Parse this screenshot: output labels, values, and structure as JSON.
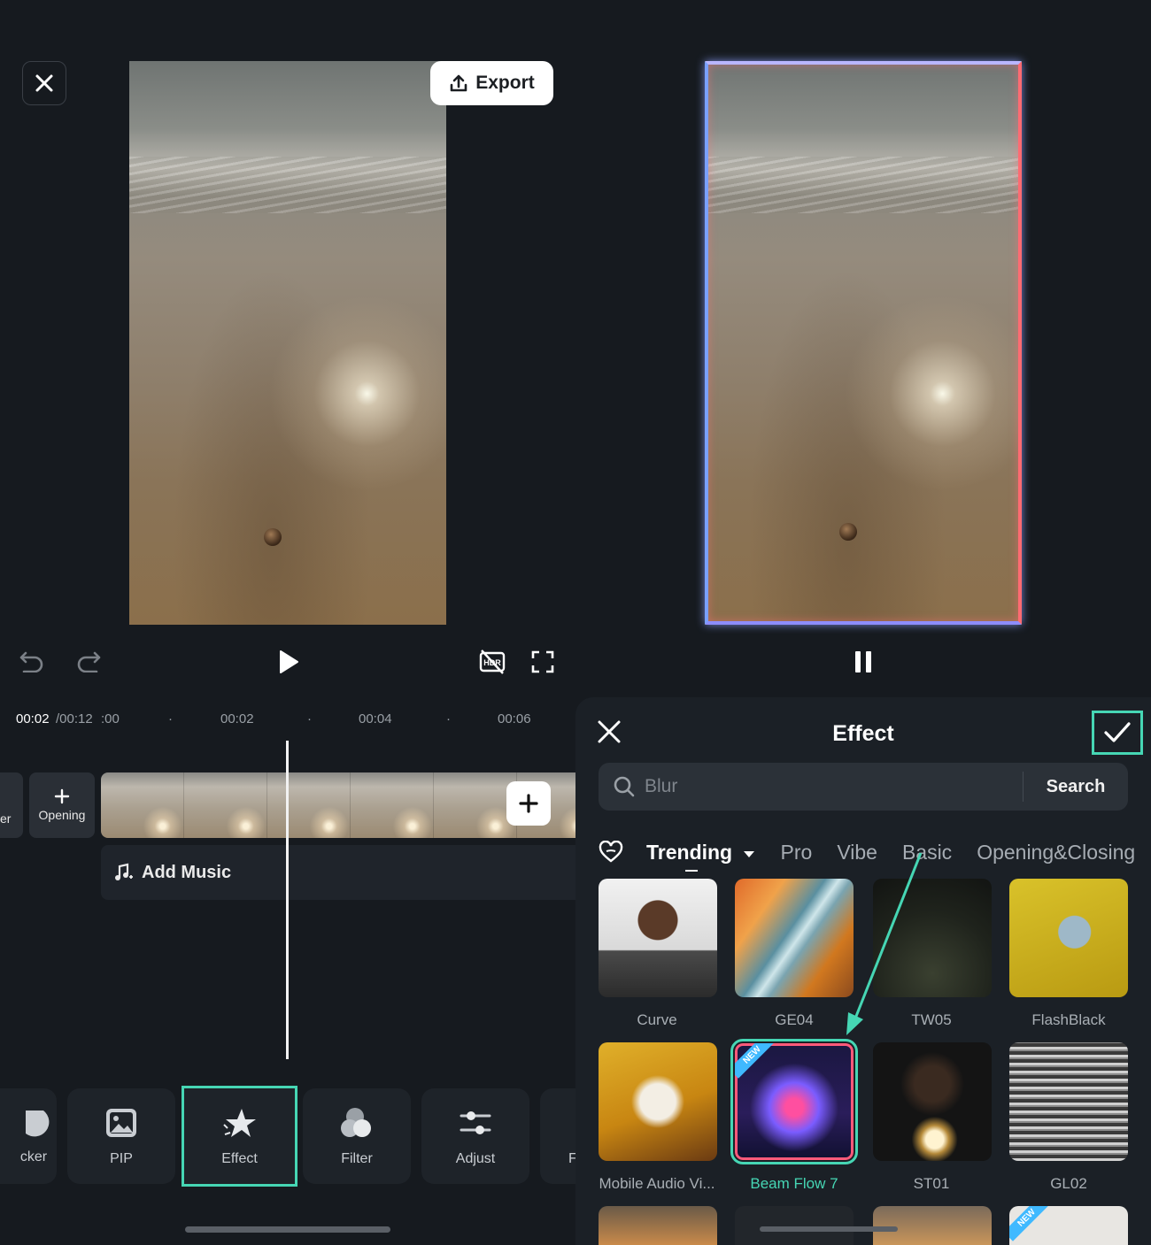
{
  "topbar": {
    "export_label": "Export"
  },
  "timeline": {
    "time_current": "00:02",
    "time_total": "/00:12",
    "ticks": [
      ":00",
      "00:02",
      "00:04",
      "00:06"
    ],
    "prev_tile_label": "er",
    "opening_label": "Opening",
    "add_music_label": "Add Music"
  },
  "toolbar": {
    "items": [
      {
        "label": "cker"
      },
      {
        "label": "PIP"
      },
      {
        "label": "Effect"
      },
      {
        "label": "Filter"
      },
      {
        "label": "Adjust"
      },
      {
        "label": "F"
      }
    ]
  },
  "effect_panel": {
    "title": "Effect",
    "search_placeholder": "Blur",
    "search_button": "Search",
    "tabs": [
      "Trending",
      "Pro",
      "Vibe",
      "Basic",
      "Opening&Closing"
    ],
    "effects": [
      {
        "name": "Curve"
      },
      {
        "name": "GE04"
      },
      {
        "name": "TW05"
      },
      {
        "name": "FlashBlack"
      },
      {
        "name": "Mobile Audio Vi..."
      },
      {
        "name": "Beam Flow 7",
        "badge": "NEW"
      },
      {
        "name": "ST01"
      },
      {
        "name": "GL02"
      }
    ],
    "bottom_badge": "NEW"
  },
  "colors": {
    "accent": "#46d6b4",
    "background": "#161a1f",
    "panel": "#1b2026"
  }
}
